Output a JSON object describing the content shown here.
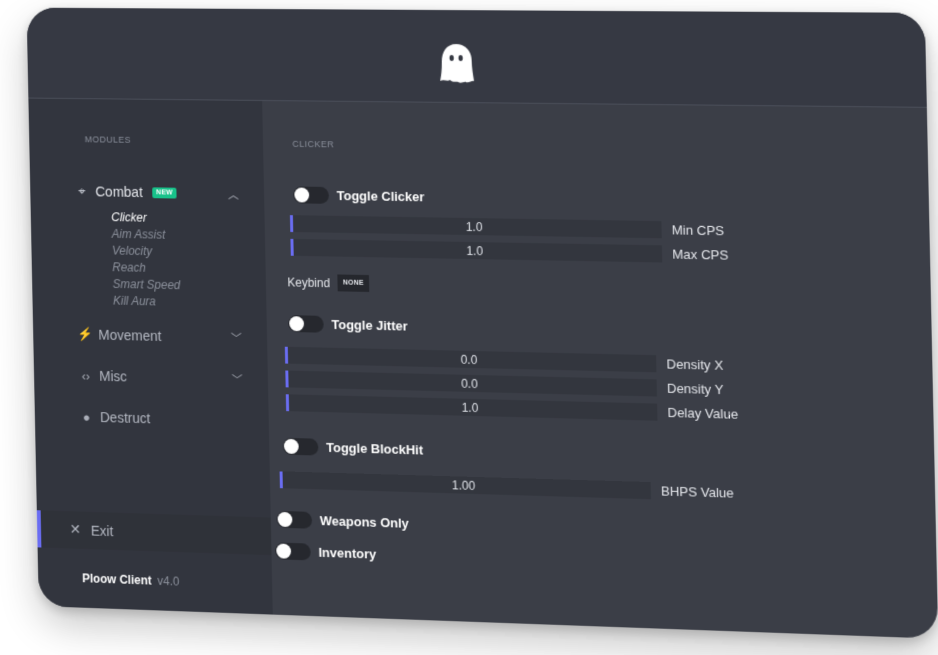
{
  "header": {
    "logo_icon": "ghost-icon"
  },
  "sidebar": {
    "section_label": "MODULES",
    "categories": [
      {
        "label": "Combat",
        "icon": "crosshair-icon",
        "badge": "NEW",
        "expanded": true
      },
      {
        "label": "Movement",
        "icon": "run-icon",
        "expanded": false
      },
      {
        "label": "Misc",
        "icon": "code-icon",
        "expanded": false
      },
      {
        "label": "Destruct",
        "icon": "bomb-icon"
      }
    ],
    "combat_items": [
      "Clicker",
      "Aim Assist",
      "Velocity",
      "Reach",
      "Smart Speed",
      "Kill Aura"
    ],
    "active_item": "Clicker",
    "exit_label": "Exit",
    "brand_name": "Ploow Client",
    "version": "v4.0"
  },
  "content": {
    "section_title": "CLICKER",
    "toggles": {
      "clicker": "Toggle Clicker",
      "jitter": "Toggle Jitter",
      "blockhit": "Toggle BlockHit",
      "weapons_only": "Weapons Only",
      "inventory": "Inventory"
    },
    "sliders": {
      "min_cps": {
        "label": "Min CPS",
        "value": "1.0"
      },
      "max_cps": {
        "label": "Max CPS",
        "value": "1.0"
      },
      "density_x": {
        "label": "Density X",
        "value": "0.0"
      },
      "density_y": {
        "label": "Density Y",
        "value": "0.0"
      },
      "delay_value": {
        "label": "Delay Value",
        "value": "1.0"
      },
      "bhps_value": {
        "label": "BHPS Value",
        "value": "1.00"
      }
    },
    "keybind": {
      "label": "Keybind",
      "value": "NONE"
    }
  },
  "colors": {
    "accent": "#6a6df2",
    "badge": "#18c28a",
    "window_bg": "#3b3e47",
    "sidebar_bg": "#32353e"
  }
}
